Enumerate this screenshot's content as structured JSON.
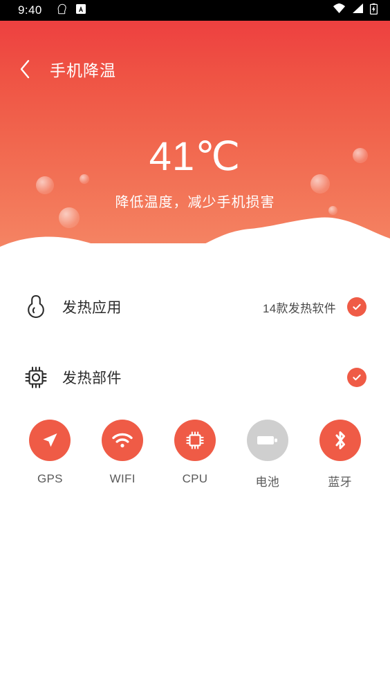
{
  "status_bar": {
    "time": "9:40",
    "left_icons": [
      "clipboard-icon",
      "app-badge-icon"
    ],
    "right_icons": [
      "wifi-icon",
      "cellular-signal-icon",
      "battery-charging-icon"
    ]
  },
  "header": {
    "back_label": "‹",
    "title": "手机降温",
    "temperature": "41℃",
    "subtitle": "降低温度，减少手机损害",
    "gradient_top": "#ED4040",
    "gradient_bottom": "#F58A68"
  },
  "rows": [
    {
      "icon": "thermometer-icon",
      "label": "发热应用",
      "count": "14款发热软件",
      "badge": "check-badge",
      "badge_color": "#EF5B46"
    },
    {
      "icon": "cpu-chip-icon",
      "label": "发热部件",
      "count": "",
      "badge": "check-badge",
      "badge_color": "#EF5B46"
    }
  ],
  "tiles": [
    {
      "icon": "gps-location-icon",
      "label": "GPS",
      "color": "#EF5B46",
      "active": true
    },
    {
      "icon": "wifi-icon",
      "label": "WIFI",
      "color": "#EF5B46",
      "active": true
    },
    {
      "icon": "cpu-chip-icon",
      "label": "CPU",
      "color": "#EF5B46",
      "active": true
    },
    {
      "icon": "battery-icon",
      "label": "电池",
      "color": "#CFCFCF",
      "active": false
    },
    {
      "icon": "bluetooth-icon",
      "label": "蓝牙",
      "color": "#EF5B46",
      "active": true
    }
  ]
}
